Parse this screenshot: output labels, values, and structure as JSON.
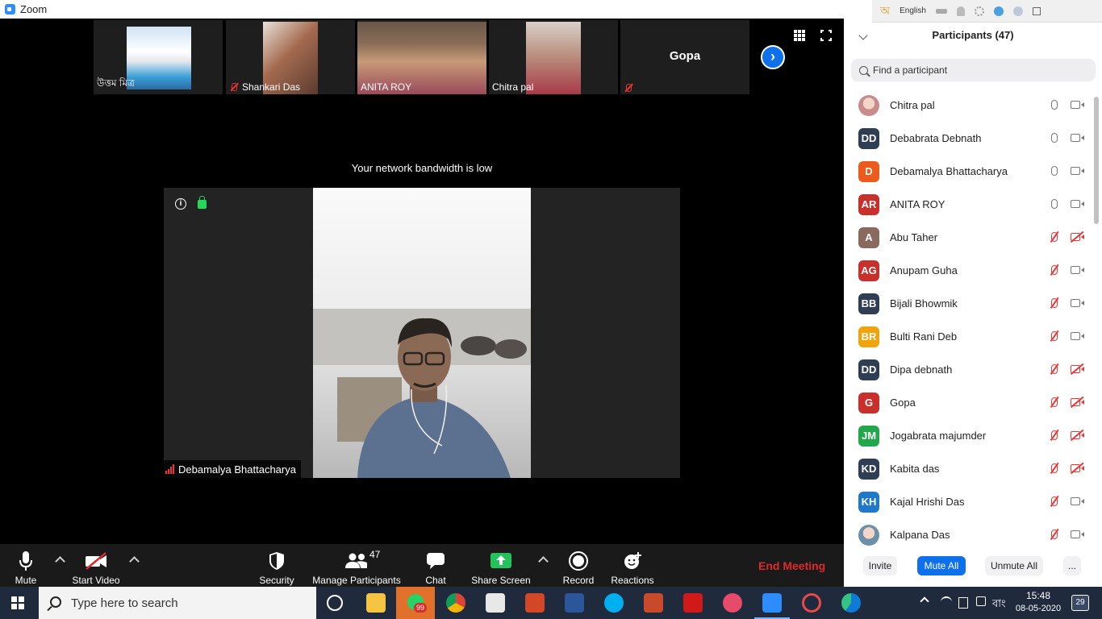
{
  "window": {
    "title": "Zoom"
  },
  "thumbnails": [
    {
      "name": "উত্তম মিত্র",
      "muted": false,
      "img_color": "#7aa6c8"
    },
    {
      "name": "Shankari Das",
      "muted": true,
      "img_color": "#a56a50"
    },
    {
      "name": "ANITA ROY",
      "muted": false,
      "img_color": "#7a5e4a"
    },
    {
      "name": "Chitra pal",
      "muted": false,
      "img_color": "#b88a7a"
    },
    {
      "name": "Gopa",
      "muted": true
    }
  ],
  "stage": {
    "bandwidth_message": "Your network bandwidth is low",
    "info_glyph": "i",
    "next_glyph": "›",
    "active_speaker": "Debamalya Bhattacharya"
  },
  "toolbar": {
    "mute_label": "Mute",
    "start_video_label": "Start Video",
    "security_label": "Security",
    "participants_label": "Manage Participants",
    "participants_count": "47",
    "chat_label": "Chat",
    "share_label": "Share Screen",
    "record_label": "Record",
    "reactions_label": "Reactions",
    "end_label": "End Meeting"
  },
  "tray_top": {
    "language": "English"
  },
  "panel": {
    "title": "Participants (47)",
    "search_placeholder": "Find a participant",
    "participants": [
      {
        "initials": "",
        "name": "Chitra pal",
        "color": "#c98b8b",
        "mic_muted": false,
        "cam_off": false,
        "photo": true
      },
      {
        "initials": "DD",
        "name": "Debabrata Debnath",
        "color": "#2f3e55",
        "mic_muted": false,
        "cam_off": false
      },
      {
        "initials": "D",
        "name": "Debamalya Bhattacharya",
        "color": "#ec5b1b",
        "mic_muted": false,
        "cam_off": false
      },
      {
        "initials": "AR",
        "name": "ANITA ROY",
        "color": "#c9302c",
        "mic_muted": false,
        "cam_off": false
      },
      {
        "initials": "A",
        "name": "Abu Taher",
        "color": "#8a6a5e",
        "mic_muted": true,
        "cam_off": true
      },
      {
        "initials": "AG",
        "name": "Anupam Guha",
        "color": "#c9302c",
        "mic_muted": true,
        "cam_off": false
      },
      {
        "initials": "BB",
        "name": "Bijali Bhowmik",
        "color": "#2f3e55",
        "mic_muted": true,
        "cam_off": false
      },
      {
        "initials": "BR",
        "name": "Bulti Rani Deb",
        "color": "#f0a30a",
        "mic_muted": true,
        "cam_off": false
      },
      {
        "initials": "DD",
        "name": "Dipa debnath",
        "color": "#2f3e55",
        "mic_muted": true,
        "cam_off": true
      },
      {
        "initials": "G",
        "name": "Gopa",
        "color": "#c9302c",
        "mic_muted": true,
        "cam_off": true
      },
      {
        "initials": "JM",
        "name": "Jogabrata majumder",
        "color": "#22a84a",
        "mic_muted": true,
        "cam_off": true
      },
      {
        "initials": "KD",
        "name": "Kabita das",
        "color": "#2f3e55",
        "mic_muted": true,
        "cam_off": true
      },
      {
        "initials": "KH",
        "name": "Kajal Hrishi Das",
        "color": "#1f78c8",
        "mic_muted": true,
        "cam_off": false
      },
      {
        "initials": "",
        "name": "Kalpana Das",
        "color": "#6d8fa8",
        "mic_muted": true,
        "cam_off": false,
        "photo": true
      }
    ],
    "invite_label": "Invite",
    "mute_all_label": "Mute All",
    "unmute_all_label": "Unmute All",
    "more_label": "..."
  },
  "taskbar": {
    "search_placeholder": "Type here to search",
    "badge_count": "99",
    "language": "বাং",
    "time": "15:48",
    "date": "08-05-2020",
    "notifications": "29"
  }
}
